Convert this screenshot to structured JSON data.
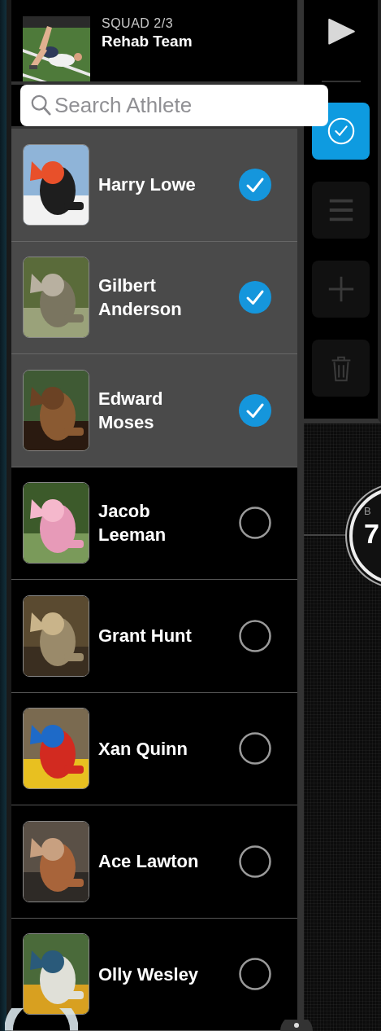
{
  "squad": {
    "label": "SQUAD 2/3",
    "name": "Rehab Team"
  },
  "search": {
    "placeholder": "Search Athlete"
  },
  "athletes": [
    {
      "name": "Harry Lowe",
      "selected": true
    },
    {
      "name": "Gilbert Anderson",
      "selected": true
    },
    {
      "name": "Edward Moses",
      "selected": true
    },
    {
      "name": "Jacob Leeman",
      "selected": false
    },
    {
      "name": "Grant Hunt",
      "selected": false
    },
    {
      "name": "Xan Quinn",
      "selected": false
    },
    {
      "name": "Ace Lawton",
      "selected": false
    },
    {
      "name": "Olly Wesley",
      "selected": false
    }
  ],
  "toolbar_buttons": [
    {
      "kind": "check",
      "selected": true
    },
    {
      "kind": "list",
      "selected": false
    },
    {
      "kind": "add",
      "selected": false
    },
    {
      "kind": "delete",
      "selected": false
    }
  ],
  "gauge": {
    "label": "B",
    "value": "7"
  }
}
